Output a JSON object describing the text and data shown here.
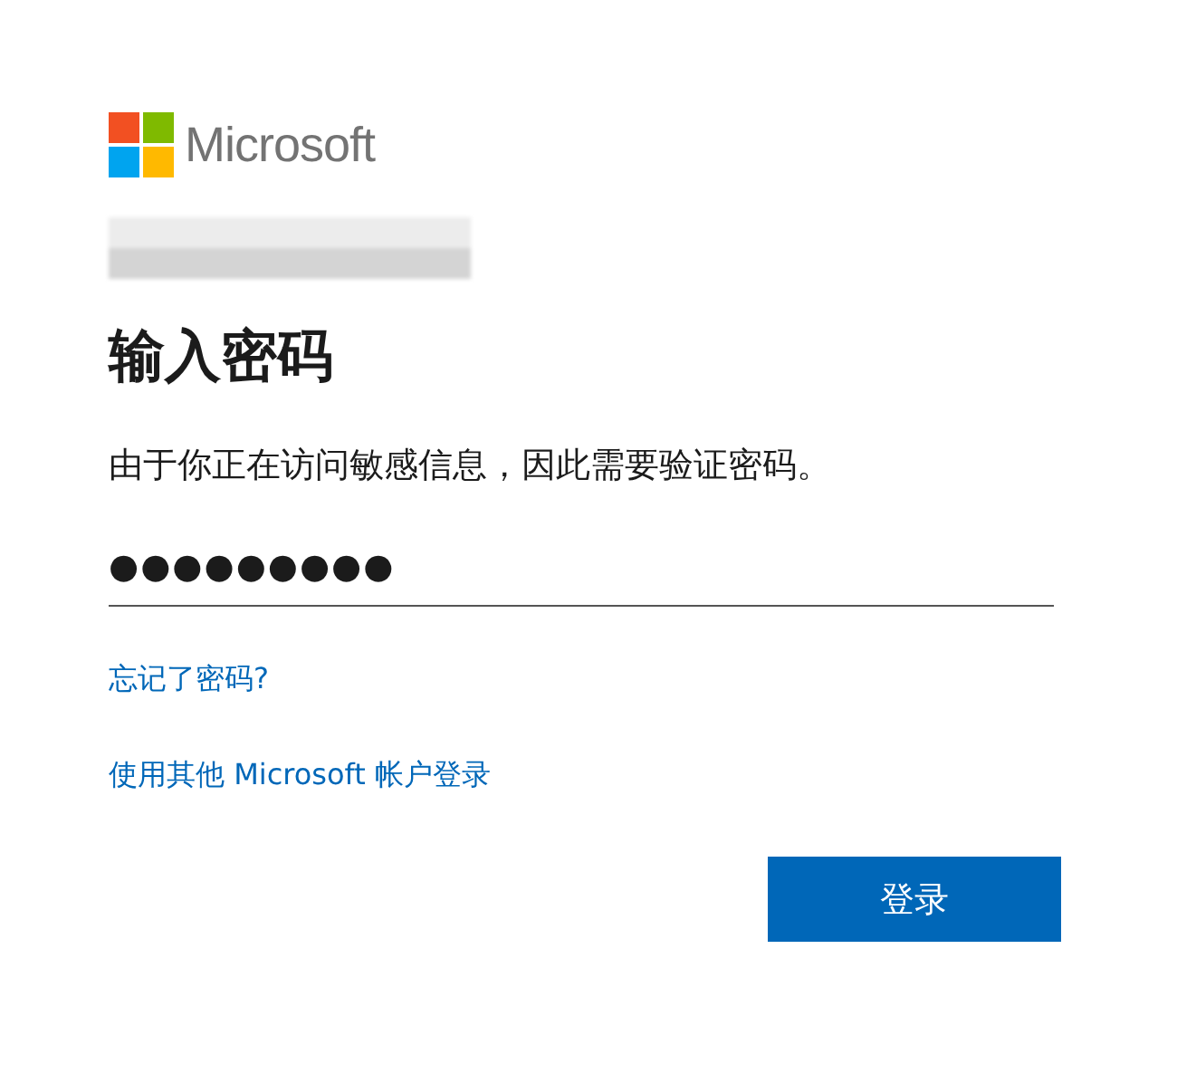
{
  "brand": {
    "name": "Microsoft"
  },
  "title": "输入密码",
  "description": "由于你正在访问敏感信息，因此需要验证密码。",
  "password_field": {
    "value": "●●●●●●●●●"
  },
  "links": [
    {
      "label": "忘记了密码?"
    },
    {
      "label": "使用其他 Microsoft 帐户登录"
    }
  ],
  "buttons": [
    {
      "label": "登录"
    }
  ]
}
